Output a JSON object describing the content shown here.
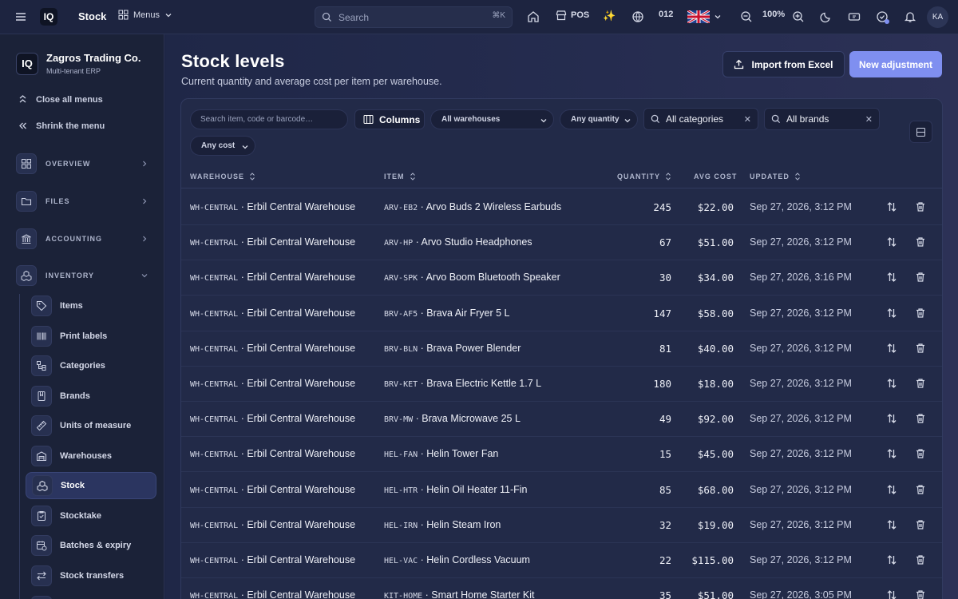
{
  "topbar": {
    "title": "Stock",
    "menus_label": "Menus",
    "search_placeholder": "Search",
    "search_shortcut": "⌘K",
    "pos_label": "POS",
    "counter": "012",
    "zoom": "100%",
    "avatar_initials": "KA"
  },
  "sidebar": {
    "org_name": "Zagros Trading Co.",
    "org_sub": "Multi-tenant ERP",
    "close_all": "Close all menus",
    "shrink": "Shrink the menu",
    "groups": [
      {
        "label": "OVERVIEW"
      },
      {
        "label": "FILES"
      },
      {
        "label": "ACCOUNTING"
      },
      {
        "label": "INVENTORY"
      }
    ],
    "items": [
      {
        "label": "Items"
      },
      {
        "label": "Print labels"
      },
      {
        "label": "Categories"
      },
      {
        "label": "Brands"
      },
      {
        "label": "Units of measure"
      },
      {
        "label": "Warehouses"
      },
      {
        "label": "Stock"
      },
      {
        "label": "Stocktake"
      },
      {
        "label": "Batches & expiry"
      },
      {
        "label": "Stock transfers"
      }
    ]
  },
  "page": {
    "title": "Stock levels",
    "subtitle": "Current quantity and average cost per item per warehouse.",
    "import_label": "Import from Excel",
    "new_label": "New adjustment"
  },
  "filters": {
    "search_placeholder": "Search item, code or barcode…",
    "columns_label": "Columns",
    "warehouses": "All warehouses",
    "quantity": "Any quantity",
    "categories": "All categories",
    "brands": "All brands",
    "cost": "Any cost"
  },
  "table": {
    "headers": [
      "WAREHOUSE",
      "ITEM",
      "QUANTITY",
      "AVG COST",
      "UPDATED"
    ],
    "rows": [
      {
        "wh_code": "WH-CENTRAL",
        "wh_name": "Erbil Central Warehouse",
        "item_code": "ARV-EB2",
        "item_name": "Arvo Buds 2 Wireless Earbuds",
        "qty": "245",
        "cost": "$22.00",
        "updated": "Sep 27, 2026, 3:12 PM"
      },
      {
        "wh_code": "WH-CENTRAL",
        "wh_name": "Erbil Central Warehouse",
        "item_code": "ARV-HP",
        "item_name": "Arvo Studio Headphones",
        "qty": "67",
        "cost": "$51.00",
        "updated": "Sep 27, 2026, 3:12 PM"
      },
      {
        "wh_code": "WH-CENTRAL",
        "wh_name": "Erbil Central Warehouse",
        "item_code": "ARV-SPK",
        "item_name": "Arvo Boom Bluetooth Speaker",
        "qty": "30",
        "cost": "$34.00",
        "updated": "Sep 27, 2026, 3:16 PM"
      },
      {
        "wh_code": "WH-CENTRAL",
        "wh_name": "Erbil Central Warehouse",
        "item_code": "BRV-AF5",
        "item_name": "Brava Air Fryer 5 L",
        "qty": "147",
        "cost": "$58.00",
        "updated": "Sep 27, 2026, 3:12 PM"
      },
      {
        "wh_code": "WH-CENTRAL",
        "wh_name": "Erbil Central Warehouse",
        "item_code": "BRV-BLN",
        "item_name": "Brava Power Blender",
        "qty": "81",
        "cost": "$40.00",
        "updated": "Sep 27, 2026, 3:12 PM"
      },
      {
        "wh_code": "WH-CENTRAL",
        "wh_name": "Erbil Central Warehouse",
        "item_code": "BRV-KET",
        "item_name": "Brava Electric Kettle 1.7 L",
        "qty": "180",
        "cost": "$18.00",
        "updated": "Sep 27, 2026, 3:12 PM"
      },
      {
        "wh_code": "WH-CENTRAL",
        "wh_name": "Erbil Central Warehouse",
        "item_code": "BRV-MW",
        "item_name": "Brava Microwave 25 L",
        "qty": "49",
        "cost": "$92.00",
        "updated": "Sep 27, 2026, 3:12 PM"
      },
      {
        "wh_code": "WH-CENTRAL",
        "wh_name": "Erbil Central Warehouse",
        "item_code": "HEL-FAN",
        "item_name": "Helin Tower Fan",
        "qty": "15",
        "cost": "$45.00",
        "updated": "Sep 27, 2026, 3:12 PM"
      },
      {
        "wh_code": "WH-CENTRAL",
        "wh_name": "Erbil Central Warehouse",
        "item_code": "HEL-HTR",
        "item_name": "Helin Oil Heater 11-Fin",
        "qty": "85",
        "cost": "$68.00",
        "updated": "Sep 27, 2026, 3:12 PM"
      },
      {
        "wh_code": "WH-CENTRAL",
        "wh_name": "Erbil Central Warehouse",
        "item_code": "HEL-IRN",
        "item_name": "Helin Steam Iron",
        "qty": "32",
        "cost": "$19.00",
        "updated": "Sep 27, 2026, 3:12 PM"
      },
      {
        "wh_code": "WH-CENTRAL",
        "wh_name": "Erbil Central Warehouse",
        "item_code": "HEL-VAC",
        "item_name": "Helin Cordless Vacuum",
        "qty": "22",
        "cost": "$115.00",
        "updated": "Sep 27, 2026, 3:12 PM"
      },
      {
        "wh_code": "WH-CENTRAL",
        "wh_name": "Erbil Central Warehouse",
        "item_code": "KIT-HOME",
        "item_name": "Smart Home Starter Kit",
        "qty": "35",
        "cost": "$51.00",
        "updated": "Sep 27, 2026, 3:05 PM"
      }
    ]
  },
  "colors": {
    "accent": "#7f8ff0",
    "background": "#1c2340"
  }
}
